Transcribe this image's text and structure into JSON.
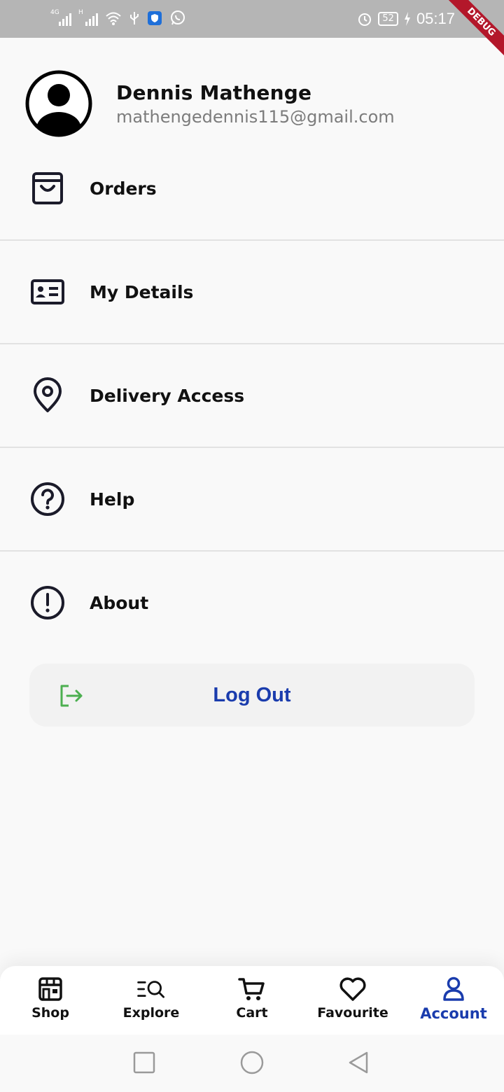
{
  "status_bar": {
    "network1": "4G",
    "network2": "H",
    "battery": "52",
    "time": "05:17",
    "debug": "DEBUG"
  },
  "profile": {
    "name": "Dennis Mathenge",
    "email": "mathengedennis115@gmail.com"
  },
  "menu": {
    "items": [
      {
        "label": "Orders",
        "icon": "shopping-bag-icon"
      },
      {
        "label": "My Details",
        "icon": "id-card-icon"
      },
      {
        "label": "Delivery Access",
        "icon": "location-pin-icon"
      },
      {
        "label": "Help",
        "icon": "help-circle-icon"
      },
      {
        "label": "About",
        "icon": "info-circle-icon"
      }
    ]
  },
  "logout": {
    "label": "Log Out",
    "icon": "logout-icon",
    "icon_color": "#4caf50",
    "text_color": "#1a3cad"
  },
  "bottom_nav": {
    "items": [
      {
        "label": "Shop",
        "icon": "store-icon"
      },
      {
        "label": "Explore",
        "icon": "explore-icon"
      },
      {
        "label": "Cart",
        "icon": "cart-icon"
      },
      {
        "label": "Favourite",
        "icon": "heart-icon"
      },
      {
        "label": "Account",
        "icon": "user-icon",
        "active": true
      }
    ],
    "active_color": "#1a3cad"
  }
}
